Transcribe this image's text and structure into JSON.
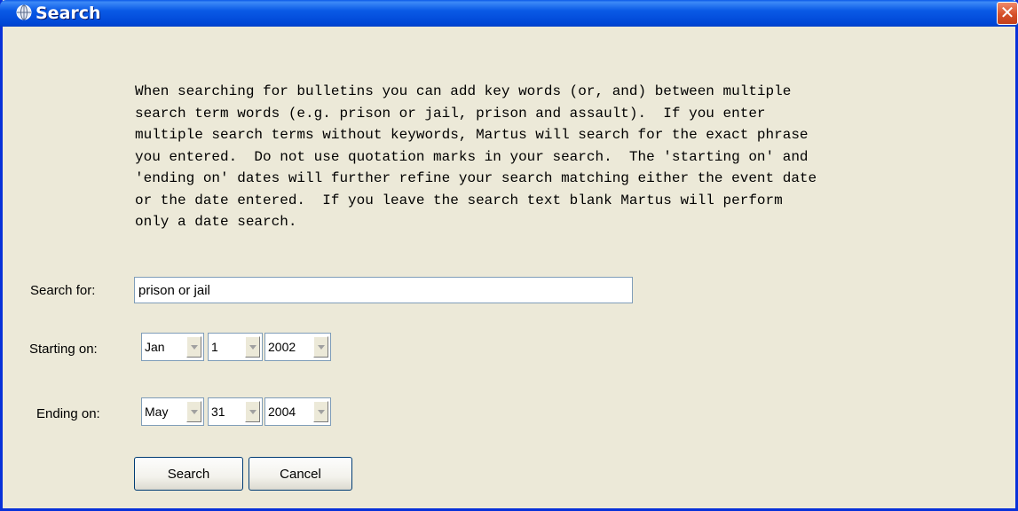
{
  "window": {
    "title": "Search",
    "icon": "globe-icon",
    "close_label": "✕"
  },
  "instructions": "When searching for bulletins you can add key words (or, and) between multiple\nsearch term words (e.g. prison or jail, prison and assault).  If you enter\nmultiple search terms without keywords, Martus will search for the exact phrase\nyou entered.  Do not use quotation marks in your search.  The 'starting on' and\n'ending on' dates will further refine your search matching either the event date\nor the date entered.  If you leave the search text blank Martus will perform\nonly a date search.",
  "search": {
    "label": "Search for:",
    "value": "prison or jail"
  },
  "starting": {
    "label": "Starting on:",
    "month": "Jan",
    "day": "1",
    "year": "2002"
  },
  "ending": {
    "label": "Ending on:",
    "month": "May",
    "day": "31",
    "year": "2004"
  },
  "buttons": {
    "search": "Search",
    "cancel": "Cancel"
  },
  "colors": {
    "titlebar": "#0a5ae6",
    "background": "#ece9d8",
    "close": "#d6512a"
  }
}
